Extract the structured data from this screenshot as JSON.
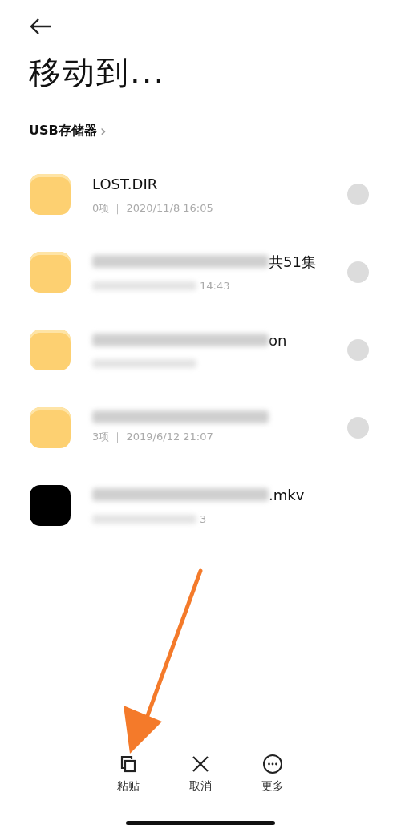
{
  "header": {
    "title": "移动到..."
  },
  "breadcrumb": {
    "label": "USB存储器",
    "separator": "›"
  },
  "items": [
    {
      "kind": "folder",
      "name": "LOST.DIR",
      "name_blurred": false,
      "meta": "0项 ｜ 2020/11/8 16:05",
      "meta_blurred": false,
      "selected": false
    },
    {
      "kind": "folder",
      "name": "共51集",
      "name_blurred": true,
      "meta": "14:43",
      "meta_blurred": true,
      "selected": false
    },
    {
      "kind": "folder",
      "name": "on",
      "name_blurred": true,
      "meta_blurred": true,
      "selected": false
    },
    {
      "kind": "folder",
      "name_blurred": true,
      "meta": "3项 ｜ 2019/6/12 21:07",
      "meta_blurred": false,
      "selected": false
    },
    {
      "kind": "video",
      "name": ".mkv",
      "name_blurred": true,
      "meta": "3",
      "meta_blurred": true
    }
  ],
  "actions": [
    {
      "kind": "paste",
      "label": "粘贴"
    },
    {
      "kind": "cancel",
      "label": "取消"
    },
    {
      "kind": "more",
      "label": "更多"
    }
  ],
  "annotation": {
    "kind": "arrow"
  }
}
